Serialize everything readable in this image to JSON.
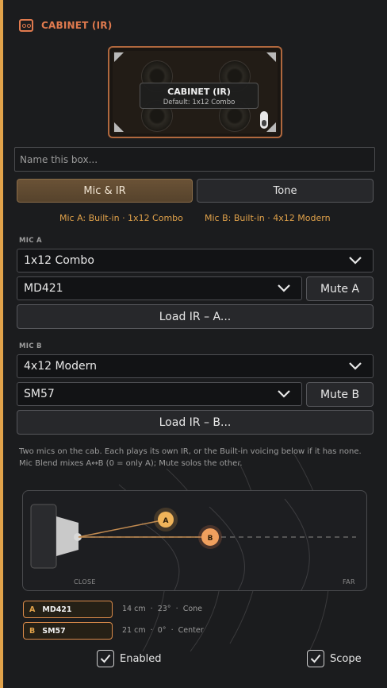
{
  "header": {
    "title": "CABINET (IR)",
    "icon": "cabinet-icon"
  },
  "cab_card": {
    "title": "CABINET (IR)",
    "subtitle": "Default: 1x12 Combo"
  },
  "name_input": {
    "placeholder": "Name this box...",
    "value": ""
  },
  "tabs": [
    {
      "label": "Mic & IR",
      "active": true
    },
    {
      "label": "Tone",
      "active": false
    }
  ],
  "summary": {
    "mic_a": "Mic A:  Built-in · 1x12 Combo",
    "mic_b": "Mic B:  Built-in · 4x12 Modern"
  },
  "mic_a": {
    "section": "MIC A",
    "cabinet": "1x12 Combo",
    "mic": "MD421",
    "mute_label": "Mute A",
    "load_label": "Load IR – A..."
  },
  "mic_b": {
    "section": "MIC B",
    "cabinet": "4x12 Modern",
    "mic": "SM57",
    "mute_label": "Mute B",
    "load_label": "Load IR – B..."
  },
  "helper_text": [
    "Two mics on the cab. Each plays its own IR, or the Built-in voicing below if it has none.",
    "Mic Blend mixes A↔B (0 = only A); Mute solos the other."
  ],
  "scope": {
    "close_label": "CLOSE",
    "far_label": "FAR",
    "markers": [
      {
        "letter": "A"
      },
      {
        "letter": "B"
      }
    ]
  },
  "mic_rows": [
    {
      "letter": "A",
      "name": "MD421",
      "distance": "14 cm",
      "angle": "23°",
      "position": "Cone"
    },
    {
      "letter": "B",
      "name": "SM57",
      "distance": "21 cm",
      "angle": "0°",
      "position": "Center"
    }
  ],
  "mic_row_sep": "·",
  "footer": {
    "enabled_label": "Enabled",
    "enabled_checked": true,
    "scope_label": "Scope",
    "scope_checked": true
  },
  "colors": {
    "accent": "#e1a24a",
    "orange": "#e07a4e",
    "background": "#1b1c1e"
  }
}
